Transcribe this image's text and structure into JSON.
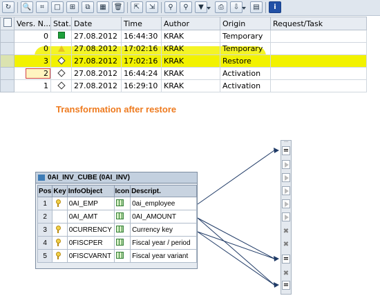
{
  "versions_table": {
    "columns": [
      "Vers. N...",
      "Stat...",
      "Date",
      "Time",
      "Author",
      "Origin",
      "Request/Task"
    ],
    "rows": [
      {
        "version": "0",
        "status": "green",
        "date": "27.08.2012",
        "time": "16:44:30",
        "author": "KRAK",
        "origin": "Temporary",
        "request": ""
      },
      {
        "version": "0",
        "status": "yellow",
        "date": "27.08.2012",
        "time": "17:02:16",
        "author": "KRAK",
        "origin": "Temporary",
        "request": ""
      },
      {
        "version": "3",
        "status": "inactive",
        "date": "27.08.2012",
        "time": "17:02:16",
        "author": "KRAK",
        "origin": "Restore",
        "request": ""
      },
      {
        "version": "2",
        "status": "inactive",
        "date": "27.08.2012",
        "time": "16:44:24",
        "author": "KRAK",
        "origin": "Activation",
        "request": ""
      },
      {
        "version": "1",
        "status": "inactive",
        "date": "27.08.2012",
        "time": "16:29:10",
        "author": "KRAK",
        "origin": "Activation",
        "request": ""
      }
    ]
  },
  "caption": "Transformation after restore",
  "infocube": {
    "title": "0AI_INV_CUBE (0AI_INV)",
    "columns": [
      "Pos",
      "Key",
      "InfoObject",
      "Icon",
      "Descript."
    ],
    "rows": [
      {
        "pos": "1",
        "key": true,
        "infoobject": "0AI_EMP",
        "description": "0ai_employee"
      },
      {
        "pos": "2",
        "key": false,
        "infoobject": "0AI_AMT",
        "description": "0AI_AMOUNT"
      },
      {
        "pos": "3",
        "key": true,
        "infoobject": "0CURRENCY",
        "description": "Currency key"
      },
      {
        "pos": "4",
        "key": true,
        "infoobject": "0FISCPER",
        "description": "Fiscal year / period"
      },
      {
        "pos": "5",
        "key": true,
        "infoobject": "0FISCVARNT",
        "description": "Fiscal year variant"
      }
    ]
  },
  "rule_column": [
    "more",
    "equals",
    "skip",
    "skip",
    "skip",
    "skip",
    "skip",
    "delete",
    "delete",
    "equals",
    "delete",
    "equals"
  ],
  "colors": {
    "highlight": "#f2f200",
    "caption": "#ee7a1e",
    "status_green": "#1fa13b",
    "status_yellow": "#e8c020"
  }
}
